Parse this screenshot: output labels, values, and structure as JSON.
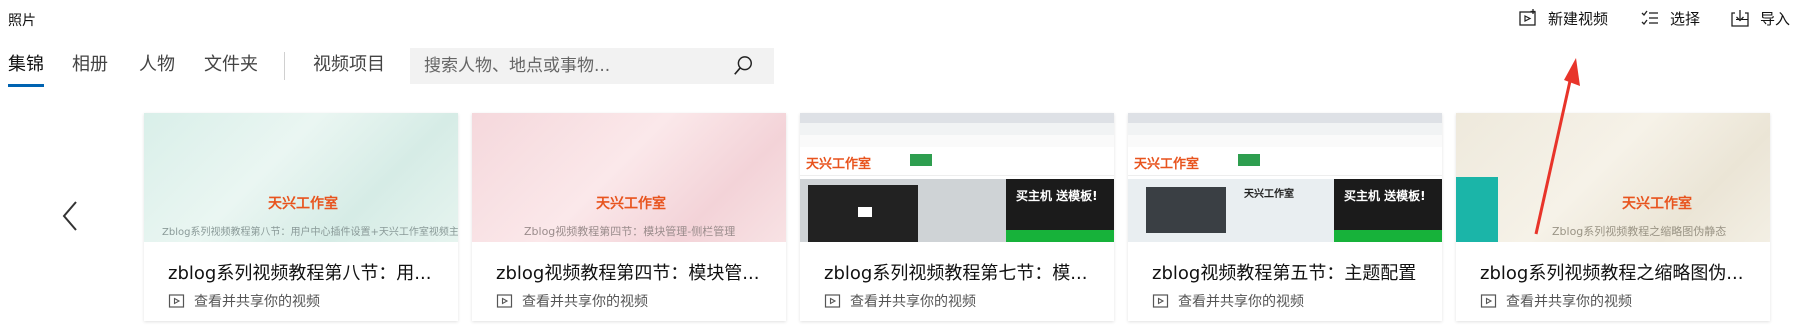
{
  "app": {
    "title": "照片"
  },
  "tabs": [
    {
      "label": "集锦",
      "active": true
    },
    {
      "label": "相册"
    },
    {
      "label": "人物"
    },
    {
      "label": "文件夹"
    },
    {
      "label": "视频项目"
    }
  ],
  "search": {
    "placeholder": "搜索人物、地点或事物..."
  },
  "actions": {
    "new_video": "新建视频",
    "select": "选择",
    "import": "导入"
  },
  "cards": [
    {
      "title": "zblog系列视频教程第八节：用...",
      "subtitle": "查看并共享你的视频",
      "thumb_logo": "天兴工作室",
      "thumb_watermark": "Zblog系列视频教程第八节：用户中心插件设置+天兴工作室视频主题设置"
    },
    {
      "title": "zblog视频教程第四节：模块管...",
      "subtitle": "查看并共享你的视频",
      "thumb_logo": "天兴工作室",
      "thumb_watermark": "Zblog视频教程第四节：模块管理-侧栏管理"
    },
    {
      "title": "zblog系列视频教程第七节：模...",
      "subtitle": "查看并共享你的视频",
      "thumb_logo": "天兴工作室",
      "thumb_ad": "买主机 送模板!"
    },
    {
      "title": "zblog视频教程第五节：主题配置",
      "subtitle": "查看并共享你的视频",
      "thumb_logo": "天兴工作室",
      "thumb_ad": "买主机 送模板!",
      "thumb_heading": "天兴工作室"
    },
    {
      "title": "zblog系列视频教程之缩略图伪...",
      "subtitle": "查看并共享你的视频",
      "thumb_logo": "天兴工作室",
      "thumb_watermark": "Zblog系列视频教程之缩略图伪静态"
    }
  ],
  "colors": {
    "accent": "#0063b1",
    "arrow": "#e8342a"
  }
}
